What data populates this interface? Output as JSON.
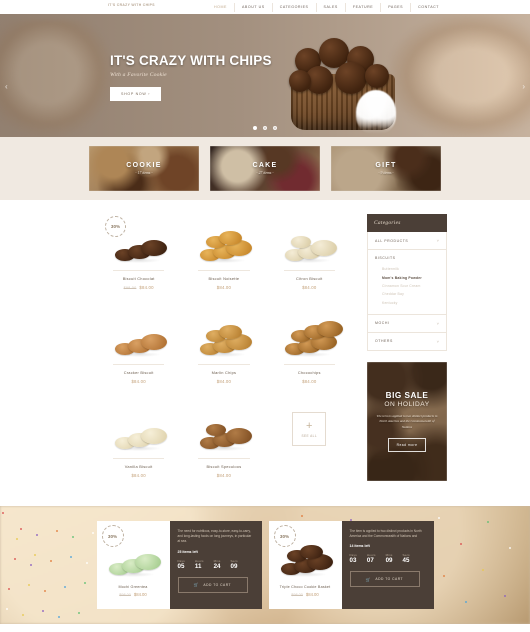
{
  "header": {
    "logo": "IT'S CRAZY WITH CHIPS",
    "nav": [
      {
        "label": "HOME",
        "active": true
      },
      {
        "label": "ABOUT US",
        "active": false
      },
      {
        "label": "CATEGORIES",
        "active": false
      },
      {
        "label": "SALES",
        "active": false
      },
      {
        "label": "FEATURE",
        "active": false
      },
      {
        "label": "PAGES",
        "active": false
      },
      {
        "label": "CONTACT",
        "active": false
      }
    ]
  },
  "hero": {
    "title": "IT'S CRAZY WITH CHIPS",
    "subtitle": "With a Favorite Cookie",
    "button": "SHOP NOW  ›",
    "prev_icon": "chevron-left-icon",
    "next_icon": "chevron-right-icon",
    "slides": 3,
    "active_slide": 1
  },
  "categories": [
    {
      "name": "COOKIE",
      "count": "- 17 items -"
    },
    {
      "name": "CAKE",
      "count": "- 27 items -"
    },
    {
      "name": "GIFT",
      "count": "- 9 items -"
    }
  ],
  "products": [
    {
      "name": "Biscuit Chocolat",
      "price": "$84.00",
      "old_price": "$98.00",
      "badge": "30%"
    },
    {
      "name": "Biscuit Noisette",
      "price": "$84.00",
      "old_price": "",
      "badge": ""
    },
    {
      "name": "Citron Biscuit",
      "price": "$84.00",
      "old_price": "",
      "badge": ""
    },
    {
      "name": "Cracker Biscuit",
      "price": "$84.00",
      "old_price": "",
      "badge": ""
    },
    {
      "name": "Marlin Chips",
      "price": "$84.00",
      "old_price": "",
      "badge": ""
    },
    {
      "name": "Chocochips",
      "price": "$84.00",
      "old_price": "",
      "badge": ""
    },
    {
      "name": "Vanilla Biscuit",
      "price": "$84.00",
      "old_price": "",
      "badge": ""
    },
    {
      "name": "Biscuit Speculoos",
      "price": "$84.00",
      "old_price": "",
      "badge": ""
    }
  ],
  "see_all": {
    "plus": "+",
    "label": "SEE ALL"
  },
  "sidebar": {
    "title": "Categories",
    "all_products": "ALL PRODUCTS",
    "group_title": "BISCUITS",
    "sub_items": [
      {
        "label": "Buttermilk",
        "active": false
      },
      {
        "label": "Mom's Baking Powder",
        "active": true
      },
      {
        "label": "Cinnamon Sour Cream",
        "active": false
      },
      {
        "label": "Cheddar Bay",
        "active": false
      },
      {
        "label": "Kentucky",
        "active": false
      }
    ],
    "groups": [
      {
        "label": "MOCHI"
      },
      {
        "label": "OTHERS"
      }
    ],
    "chevron": "˅"
  },
  "promo": {
    "title": "BIG SALE",
    "subtitle": "ON HOLIDAY",
    "description": "The term is applied to two distinct products in North America and the Commonwealth of Nations",
    "button": "Read more"
  },
  "deals": [
    {
      "badge": "30%",
      "name": "Mochi Greentea",
      "price": "$84.00",
      "old_price": "$98.00",
      "description": "The need for nutritious, easy-to-store, easy-to-carry, and long-lasting foods on long journeys, in particular at sea.",
      "items_left": "25 items left",
      "countdown": [
        {
          "label": "Days",
          "value": "05"
        },
        {
          "label": "Hours",
          "value": "11"
        },
        {
          "label": "Mins",
          "value": "24"
        },
        {
          "label": "Secs",
          "value": "09"
        }
      ],
      "cart_label": "ADD TO CART",
      "cart_icon": "cart-icon"
    },
    {
      "badge": "30%",
      "name": "Triple Choco Cookie Basket",
      "price": "$84.00",
      "old_price": "$98.00",
      "description": "The item is applied to two distinct products in North America and the Commonwealth of Nations and",
      "items_left": "14 items left",
      "countdown": [
        {
          "label": "Days",
          "value": "03"
        },
        {
          "label": "Hours",
          "value": "07"
        },
        {
          "label": "Mins",
          "value": "09"
        },
        {
          "label": "Secs",
          "value": "45"
        }
      ],
      "cart_label": "ADD TO CART",
      "cart_icon": "cart-icon"
    }
  ],
  "colors": {
    "accent": "#c3a078",
    "dark": "#4b3f37",
    "band": "#f0e9e1"
  }
}
